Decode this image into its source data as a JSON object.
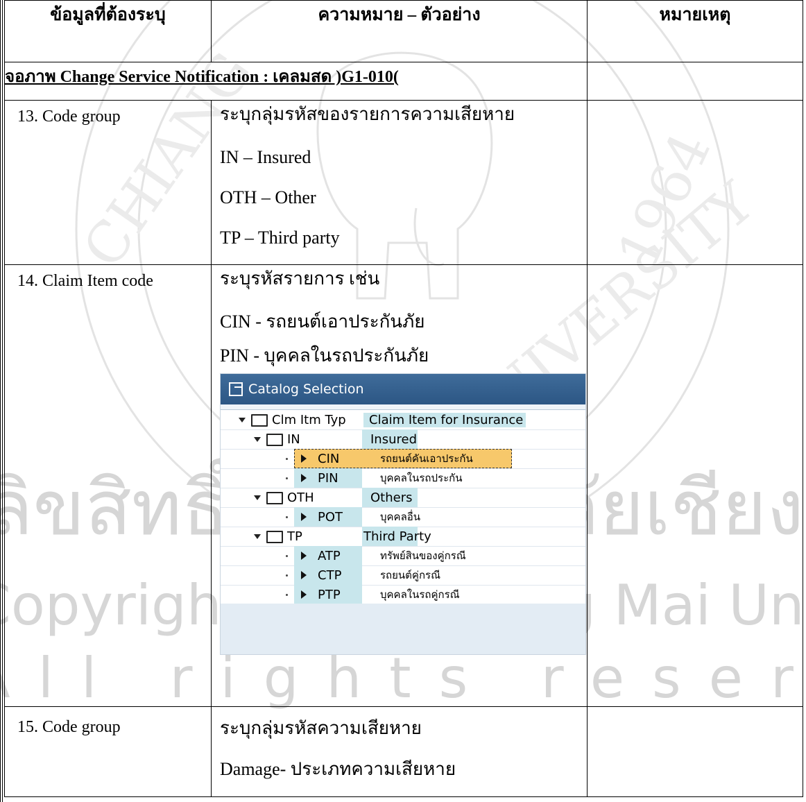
{
  "table": {
    "headers": {
      "col1": "ข้อมูลที่ต้องระบุ",
      "col2": "ความหมาย – ตัวอย่าง",
      "col3": "หมายเหตุ"
    },
    "section_title": "จอภาพ Change Service Notification : เคลมสด )G1-010(",
    "rows": [
      {
        "label": "13.  Code group",
        "lines": [
          "ระบุกลุ่มรหัสของรายการความเสียหาย",
          "IN – Insured",
          "OTH – Other",
          "TP – Third party"
        ]
      },
      {
        "label": "14.  Claim Item code",
        "lines": [
          "ระบุรหัสรายการ เช่น",
          "CIN - รถยนต์เอาประกันภัย",
          "PIN - บุคคลในรถประกันภัย"
        ]
      },
      {
        "label": "15.  Code group",
        "lines": [
          "ระบุกลุ่มรหัสความเสียหาย",
          "Damage- ประเภทความเสียหาย"
        ]
      }
    ]
  },
  "catalog": {
    "title": "Catalog Selection",
    "rows": [
      {
        "code": "Clm Itm Typ",
        "desc": "Claim Item for Insurance",
        "level": 0,
        "type": "folder"
      },
      {
        "code": "IN",
        "desc": "Insured",
        "level": 1,
        "type": "folder"
      },
      {
        "code": "CIN",
        "desc": "รถยนต์คันเอาประกัน",
        "level": 2,
        "type": "leaf",
        "selected": true
      },
      {
        "code": "PIN",
        "desc": "บุคคลในรถประกัน",
        "level": 2,
        "type": "leaf"
      },
      {
        "code": "OTH",
        "desc": "Others",
        "level": 1,
        "type": "folder"
      },
      {
        "code": "POT",
        "desc": "บุคคลอื่น",
        "level": 2,
        "type": "leaf"
      },
      {
        "code": "TP",
        "desc": "Third Party",
        "level": 1,
        "type": "folder-open"
      },
      {
        "code": "ATP",
        "desc": "ทรัพย์สินของคู่กรณี",
        "level": 2,
        "type": "leaf"
      },
      {
        "code": "CTP",
        "desc": "รถยนต์คู่กรณี",
        "level": 2,
        "type": "leaf"
      },
      {
        "code": "PTP",
        "desc": "บุคคลในรถคู่กรณี",
        "level": 2,
        "type": "leaf"
      }
    ]
  },
  "watermark": {
    "line1": "ลิขสิทธิ์มหาวิทยาลัยเชียงใหม่",
    "line2": "Copyright© by Chiang Mai University",
    "line3": "All rights reserved",
    "seal_text_top": "CHIANG MAI UNIVERSITY",
    "seal_year": "1964"
  }
}
